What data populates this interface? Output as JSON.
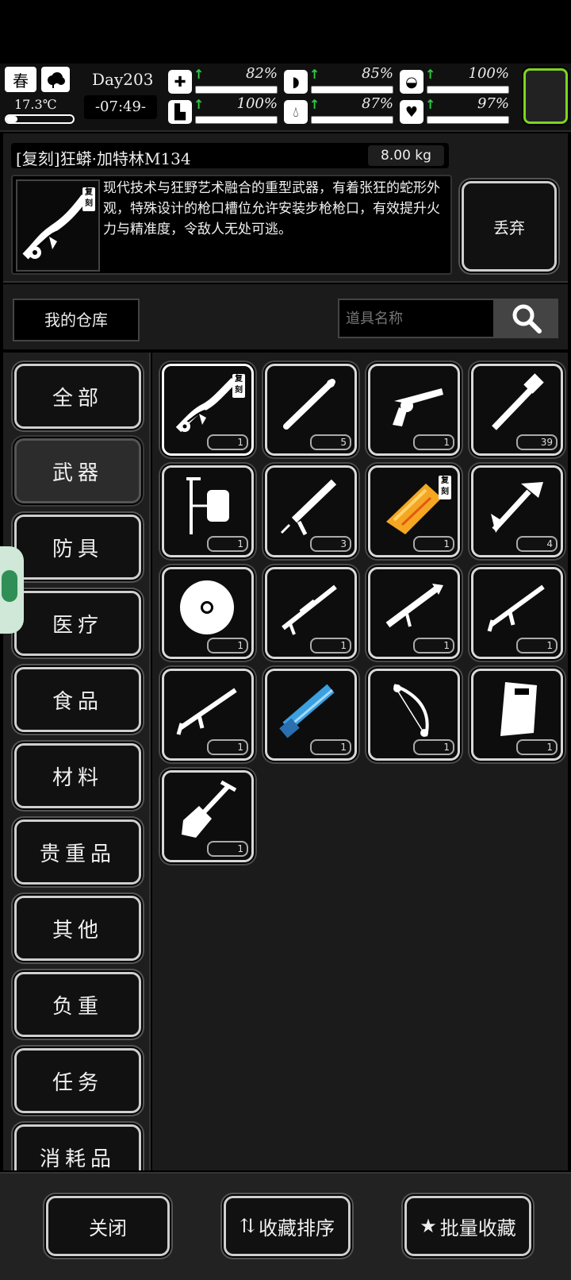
{
  "status": {
    "season": "春",
    "temperature": "17.3℃",
    "day": "Day203",
    "time": "-07:49-",
    "stats": [
      {
        "icon": "medkit-icon",
        "value": "82%",
        "level": 0.82
      },
      {
        "icon": "stomach-icon",
        "value": "85%",
        "level": 0.85
      },
      {
        "icon": "bladder-icon",
        "value": "100%",
        "level": 1.0
      },
      {
        "icon": "boot-icon",
        "value": "100%",
        "level": 1.0
      },
      {
        "icon": "water-drop-icon",
        "value": "87%",
        "level": 0.87
      },
      {
        "icon": "heart-icon",
        "value": "97%",
        "level": 0.97
      }
    ]
  },
  "item": {
    "name": "[复刻]狂蟒·加特林M134",
    "weight": "8.00 kg",
    "badge": "复刻",
    "description": "现代技术与狂野艺术融合的重型武器，有着张狂的蛇形外观，特殊设计的枪口槽位允许安装步枪枪口，有效提升火力与精准度，令敌人无处可逃。",
    "discard_label": "丢弃"
  },
  "warehouse": {
    "tab_label": "我的仓库",
    "search_placeholder": "道具名称"
  },
  "categories": [
    "全部",
    "武器",
    "防具",
    "医疗",
    "食品",
    "材料",
    "贵重品",
    "其他",
    "负重",
    "任务",
    "消耗品"
  ],
  "active_category": "武器",
  "items": [
    {
      "name": "serpent-gatling",
      "count": "1",
      "copy": true
    },
    {
      "name": "pipe",
      "count": "5"
    },
    {
      "name": "revolver",
      "count": "1"
    },
    {
      "name": "wrench-pipe",
      "count": "39"
    },
    {
      "name": "sprayer",
      "count": "1"
    },
    {
      "name": "caulk-gun",
      "count": "3"
    },
    {
      "name": "gold-blaster",
      "count": "1",
      "copy": true
    },
    {
      "name": "hammer-axe",
      "count": "4"
    },
    {
      "name": "round-shield",
      "count": "1"
    },
    {
      "name": "sniper-rifle",
      "count": "1"
    },
    {
      "name": "rocket-launcher",
      "count": "1"
    },
    {
      "name": "assault-rifle",
      "count": "1"
    },
    {
      "name": "rifle",
      "count": "1"
    },
    {
      "name": "blue-minigun",
      "count": "1"
    },
    {
      "name": "compound-bow",
      "count": "1"
    },
    {
      "name": "riot-shield",
      "count": "1"
    },
    {
      "name": "shovel",
      "count": "1"
    }
  ],
  "bottom": {
    "close": "关闭",
    "sort": "收藏排序",
    "batch": "批量收藏"
  },
  "colors": {
    "accent_green": "#2ecc40",
    "frame": "#d8d8d8",
    "gold": "#f5a623",
    "blue": "#3aa0e0"
  }
}
